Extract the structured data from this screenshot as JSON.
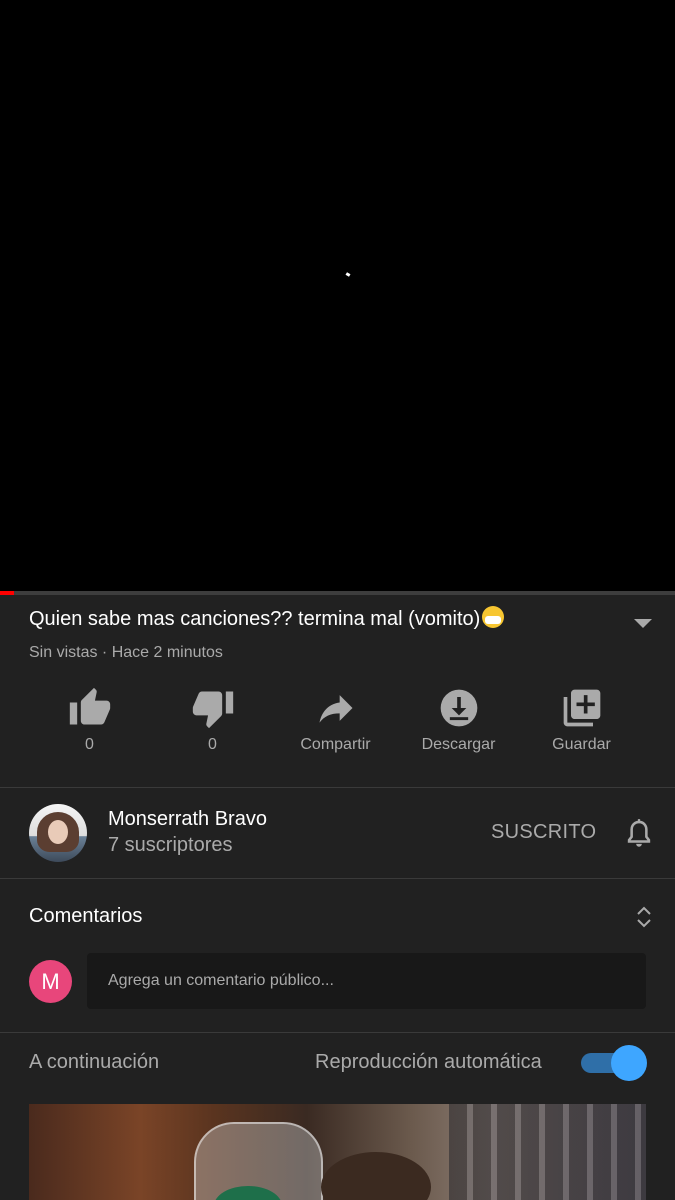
{
  "player": {
    "progress_fraction": 0.02,
    "progress_color": "#ff0000"
  },
  "video": {
    "title": "Quien sabe mas canciones?? termina mal (vomito)",
    "title_emoji": "face-with-medical-mask-emoji",
    "meta": "Sin vistas · Hace 2 minutos"
  },
  "actions": [
    {
      "icon": "thumbs-up-icon",
      "label": "0"
    },
    {
      "icon": "thumbs-down-icon",
      "label": "0"
    },
    {
      "icon": "share-icon",
      "label": "Compartir"
    },
    {
      "icon": "download-icon",
      "label": "Descargar"
    },
    {
      "icon": "add-to-playlist-icon",
      "label": "Guardar"
    }
  ],
  "channel": {
    "name": "Monserrath Bravo",
    "subscribers": "7 suscriptores",
    "subscribe_label": "SUSCRITO",
    "bell_icon": "bell-icon"
  },
  "comments": {
    "title": "Comentarios",
    "user_initial": "M",
    "user_avatar_color": "#e8467b",
    "placeholder": "Agrega un comentario público..."
  },
  "up_next": {
    "label": "A continuación",
    "autoplay_label": "Reproducción automática",
    "autoplay_on": true,
    "accent_color": "#3ea6ff"
  }
}
